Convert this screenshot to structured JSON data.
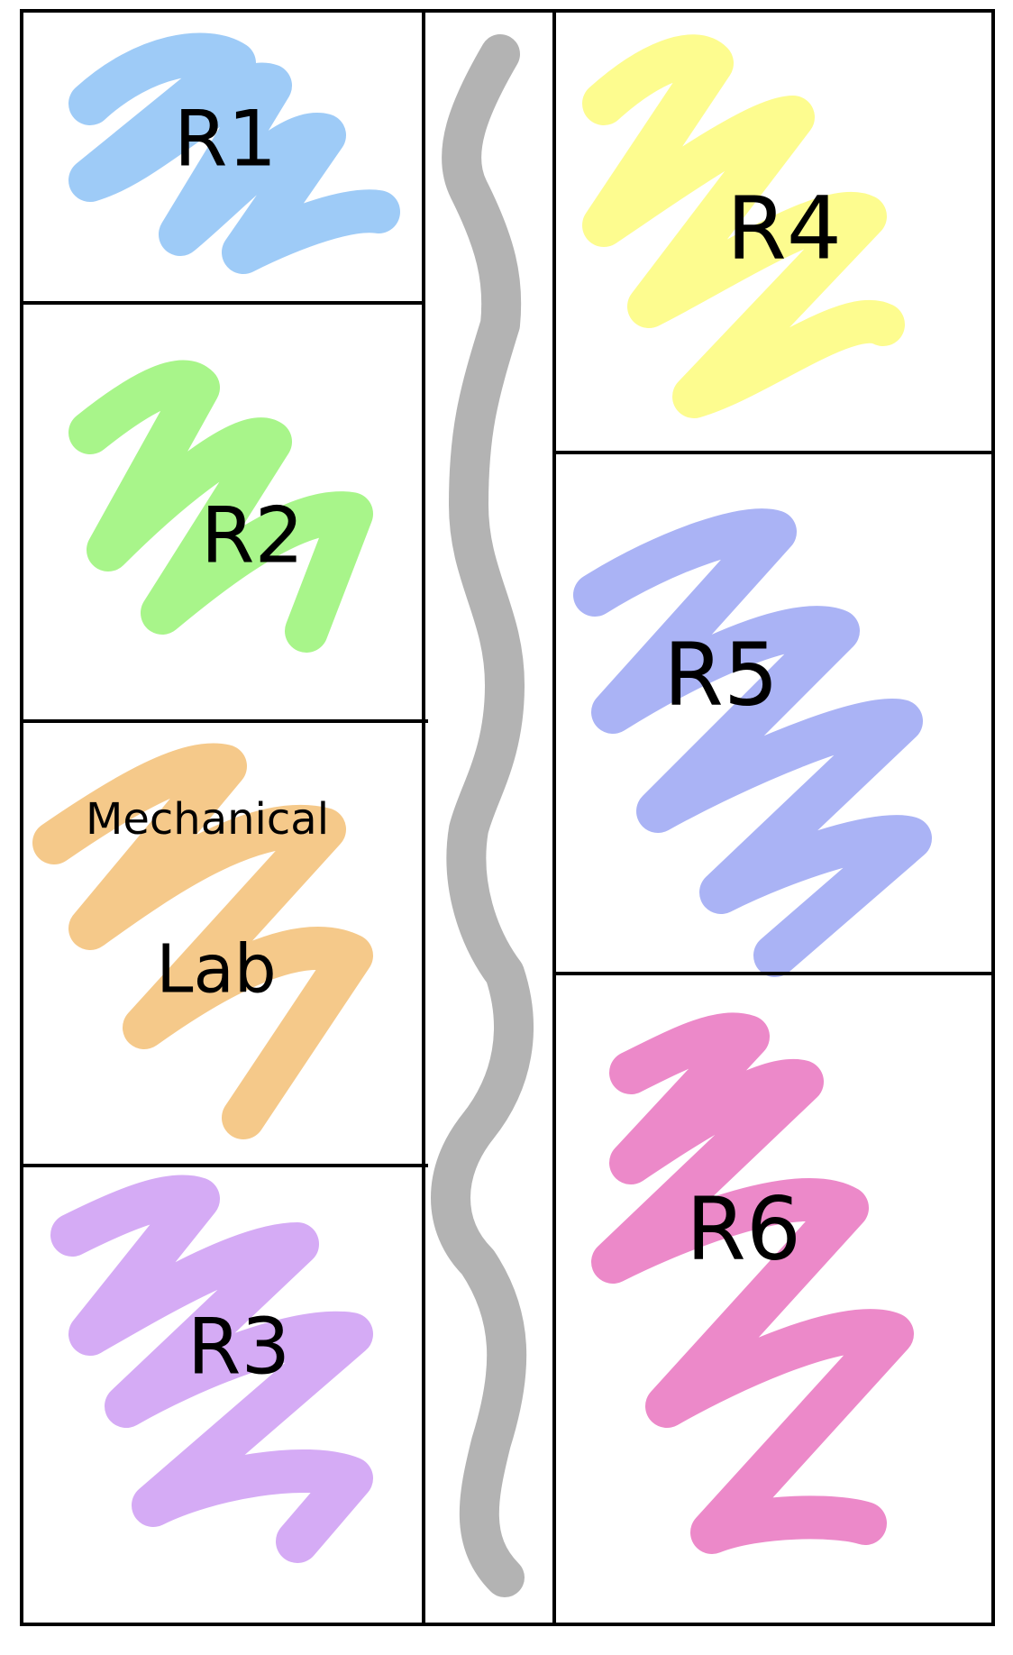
{
  "rooms": [
    {
      "id": "r1",
      "label": "R1",
      "color": "#9ecbf7"
    },
    {
      "id": "r2",
      "label": "R2",
      "color": "#a8f58a"
    },
    {
      "id": "lab",
      "label_line1": "Mechanical",
      "label_line2": "Lab",
      "color": "#f5c98a"
    },
    {
      "id": "r3",
      "label": "R3",
      "color": "#d5abf5"
    },
    {
      "id": "r4",
      "label": "R4",
      "color": "#fdfc8f"
    },
    {
      "id": "r5",
      "label": "R5",
      "color": "#aab3f5"
    },
    {
      "id": "r6",
      "label": "R6",
      "color": "#ec89c9"
    }
  ],
  "corridor": {
    "color": "#b3b3b3"
  }
}
